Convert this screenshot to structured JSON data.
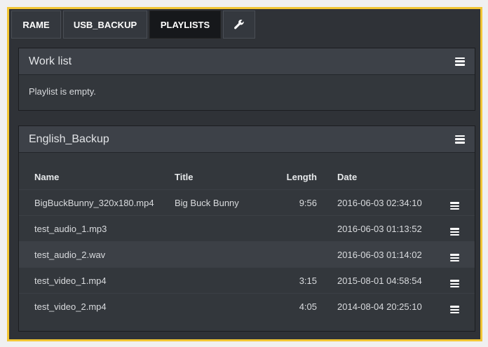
{
  "tabs": [
    {
      "label": "RAME"
    },
    {
      "label": "USB_BACKUP"
    },
    {
      "label": "PLAYLISTS",
      "active": true
    },
    {
      "icon": "wrench-icon"
    }
  ],
  "panels": [
    {
      "title": "Work list",
      "empty_message": "Playlist is empty."
    },
    {
      "title": "English_Backup",
      "columns": [
        "Name",
        "Title",
        "Length",
        "Date"
      ],
      "rows": [
        {
          "name": "BigBuckBunny_320x180.mp4",
          "title": "Big Buck Bunny",
          "length": "9:56",
          "date": "2016-06-03 02:34:10"
        },
        {
          "name": "test_audio_1.mp3",
          "title": "",
          "length": "",
          "date": "2016-06-03 01:13:52"
        },
        {
          "name": "test_audio_2.wav",
          "title": "",
          "length": "",
          "date": "2016-06-03 01:14:02"
        },
        {
          "name": "test_video_1.mp4",
          "title": "",
          "length": "3:15",
          "date": "2015-08-01 04:58:54"
        },
        {
          "name": "test_video_2.mp4",
          "title": "",
          "length": "4:05",
          "date": "2014-08-04 20:25:10"
        }
      ]
    }
  ],
  "colors": {
    "accent_border": "#f2c634",
    "background": "#2f3237",
    "active_tab": "#16181b"
  }
}
